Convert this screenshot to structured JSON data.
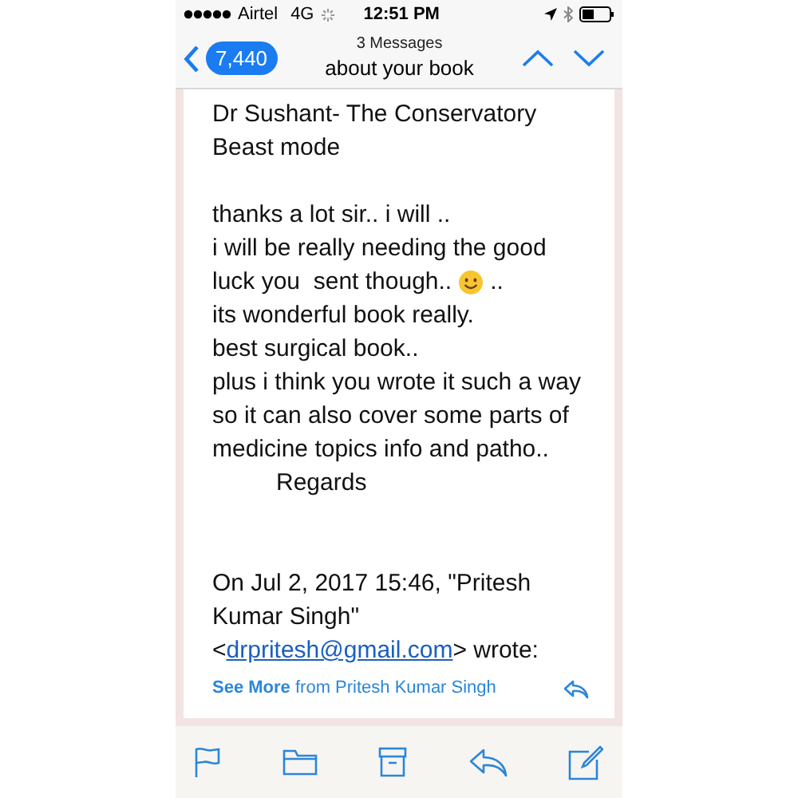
{
  "status_bar": {
    "carrier": "Airtel",
    "network": "4G",
    "time": "12:51 PM"
  },
  "nav": {
    "unread_count": "7,440",
    "subtitle": "3 Messages",
    "title": "about your book"
  },
  "message": {
    "paragraphs": [
      {
        "lines": [
          {
            "text": "Dr Sushant- The Conservatory"
          },
          {
            "text": "Beast mode"
          }
        ]
      },
      {
        "lines": [
          {
            "text": "thanks a lot sir.. i will .."
          },
          {
            "text": "i will be really needing the good"
          },
          {
            "text": "luck you  sent though..",
            "emoji": true,
            "after": ".."
          },
          {
            "text": "its wonderful book really."
          },
          {
            "text": "best surgical book.."
          },
          {
            "text": "plus i think you wrote it such a way"
          },
          {
            "text": "so it can also cover some parts of"
          },
          {
            "text": "medicine topics info and patho.."
          },
          {
            "text": "Regards",
            "indented": true
          }
        ]
      }
    ],
    "quote_header": {
      "lines": [
        "On Jul 2, 2017 15:46, \"Pritesh",
        "Kumar Singh\""
      ],
      "link_before": "<",
      "link": "drpritesh@gmail.com",
      "link_after": "> wrote:"
    },
    "see_more": "**See More** from Pritesh Kumar Singh"
  }
}
